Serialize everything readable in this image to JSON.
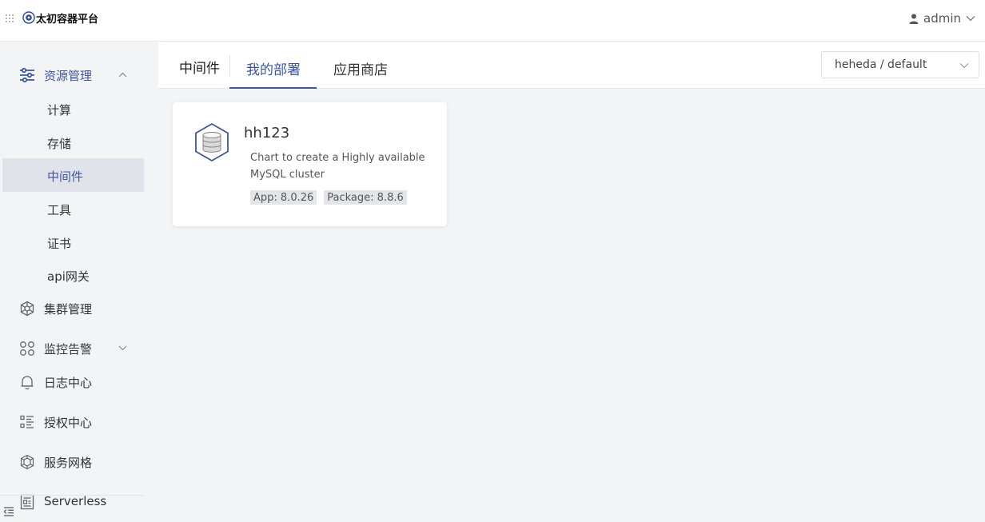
{
  "header": {
    "app_title": "太初容器平台",
    "user_name": "admin"
  },
  "sidebar": {
    "groups": [
      {
        "label": "资源管理",
        "icon": "sliders-icon",
        "expanded": true
      },
      {
        "label": "集群管理",
        "icon": "helm-icon"
      },
      {
        "label": "监控告警",
        "icon": "monitor-icon",
        "expanded": false
      },
      {
        "label": "日志中心",
        "icon": "bell-icon"
      },
      {
        "label": "授权中心",
        "icon": "list-icon"
      },
      {
        "label": "服务网格",
        "icon": "mesh-icon"
      },
      {
        "label": "Serverless",
        "icon": "serverless-icon"
      }
    ],
    "sub_items": [
      {
        "label": "计算"
      },
      {
        "label": "存储"
      },
      {
        "label": "中间件",
        "selected": true
      },
      {
        "label": "工具"
      },
      {
        "label": "证书"
      },
      {
        "label": "api网关"
      }
    ]
  },
  "main": {
    "section_title": "中间件",
    "tabs": [
      {
        "label": "我的部署",
        "active": true
      },
      {
        "label": "应用商店",
        "active": false
      }
    ],
    "namespace_select": {
      "value": "heheda / default"
    }
  },
  "cards": [
    {
      "name": "hh123",
      "description": "Chart to create a Highly available MySQL cluster",
      "app_version": "App: 8.0.26",
      "package_version": "Package: 8.8.6",
      "icon": "database-icon"
    }
  ],
  "colors": {
    "accent": "#3d55a0",
    "background": "#f3f4f6",
    "selected_bg": "#e1e3ea"
  }
}
